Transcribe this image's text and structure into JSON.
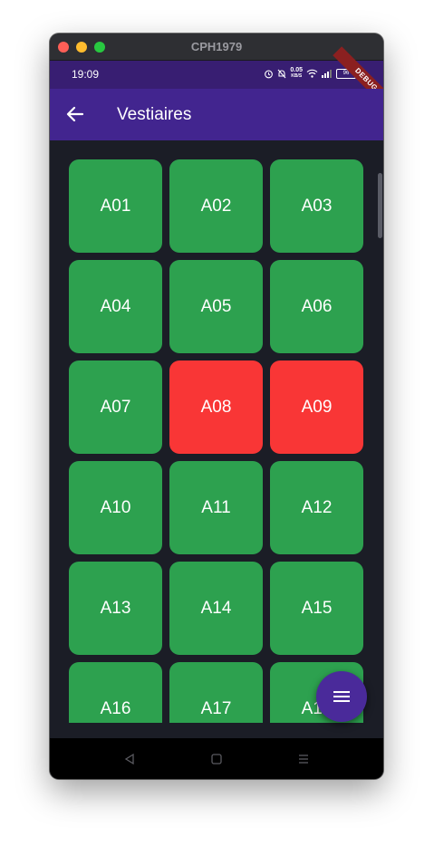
{
  "window": {
    "title": "CPH1979"
  },
  "statusbar": {
    "time": "19:09",
    "net_speed_value": "0.05",
    "net_speed_unit": "KB/S",
    "battery": "96",
    "icons": [
      "alarm-icon",
      "mute-icon",
      "wifi-icon",
      "signal-icon",
      "battery-icon"
    ]
  },
  "debug_banner": "DEBUG",
  "appbar": {
    "title": "Vestiaires",
    "back_icon": "arrow-back-icon"
  },
  "lockers": [
    {
      "label": "A01",
      "status": "free"
    },
    {
      "label": "A02",
      "status": "free"
    },
    {
      "label": "A03",
      "status": "free"
    },
    {
      "label": "A04",
      "status": "free"
    },
    {
      "label": "A05",
      "status": "free"
    },
    {
      "label": "A06",
      "status": "free"
    },
    {
      "label": "A07",
      "status": "free"
    },
    {
      "label": "A08",
      "status": "occupied"
    },
    {
      "label": "A09",
      "status": "occupied"
    },
    {
      "label": "A10",
      "status": "free"
    },
    {
      "label": "A11",
      "status": "free"
    },
    {
      "label": "A12",
      "status": "free"
    },
    {
      "label": "A13",
      "status": "free"
    },
    {
      "label": "A14",
      "status": "free"
    },
    {
      "label": "A15",
      "status": "free"
    },
    {
      "label": "A16",
      "status": "free"
    },
    {
      "label": "A17",
      "status": "free"
    },
    {
      "label": "A18",
      "status": "free"
    }
  ],
  "colors": {
    "free": "#2da14f",
    "occupied": "#f93636",
    "appbar": "#42258f",
    "fab": "#4a2a9a"
  },
  "fab": {
    "icon": "menu-icon"
  },
  "navbar": {
    "icons": [
      "nav-back-icon",
      "nav-home-icon",
      "nav-recents-icon"
    ]
  }
}
